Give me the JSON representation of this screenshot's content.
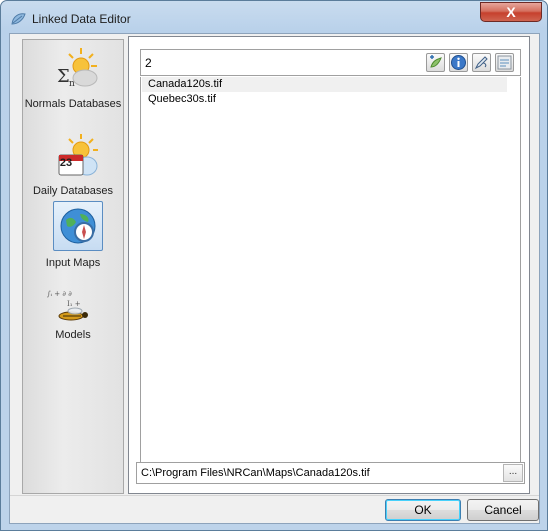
{
  "window": {
    "title": "Linked Data Editor",
    "close_glyph": "X"
  },
  "sidebar": {
    "items": [
      {
        "label": "Normals Databases",
        "icon": "normals-database-icon"
      },
      {
        "label": "Daily Databases",
        "icon": "daily-database-icon",
        "calendar_day": "23"
      },
      {
        "label": "Input Maps",
        "icon": "input-maps-icon",
        "selected": true
      },
      {
        "label": "Models",
        "icon": "models-icon"
      }
    ]
  },
  "panel": {
    "count_value": "2",
    "toolbar": [
      "add-icon",
      "info-icon",
      "edit-link-icon",
      "options-icon"
    ],
    "files": [
      {
        "name": "Canada120s.tif",
        "selected": true
      },
      {
        "name": "Quebec30s.tif",
        "selected": false
      }
    ]
  },
  "path_field": {
    "value": "C:\\Program Files\\NRCan\\Maps\\Canada120s.tif",
    "browse_label": "..."
  },
  "buttons": {
    "ok": "OK",
    "cancel": "Cancel"
  },
  "colors": {
    "accent": "#3c7fb1",
    "close": "#c6402d",
    "selection": "#f0f0f0"
  }
}
